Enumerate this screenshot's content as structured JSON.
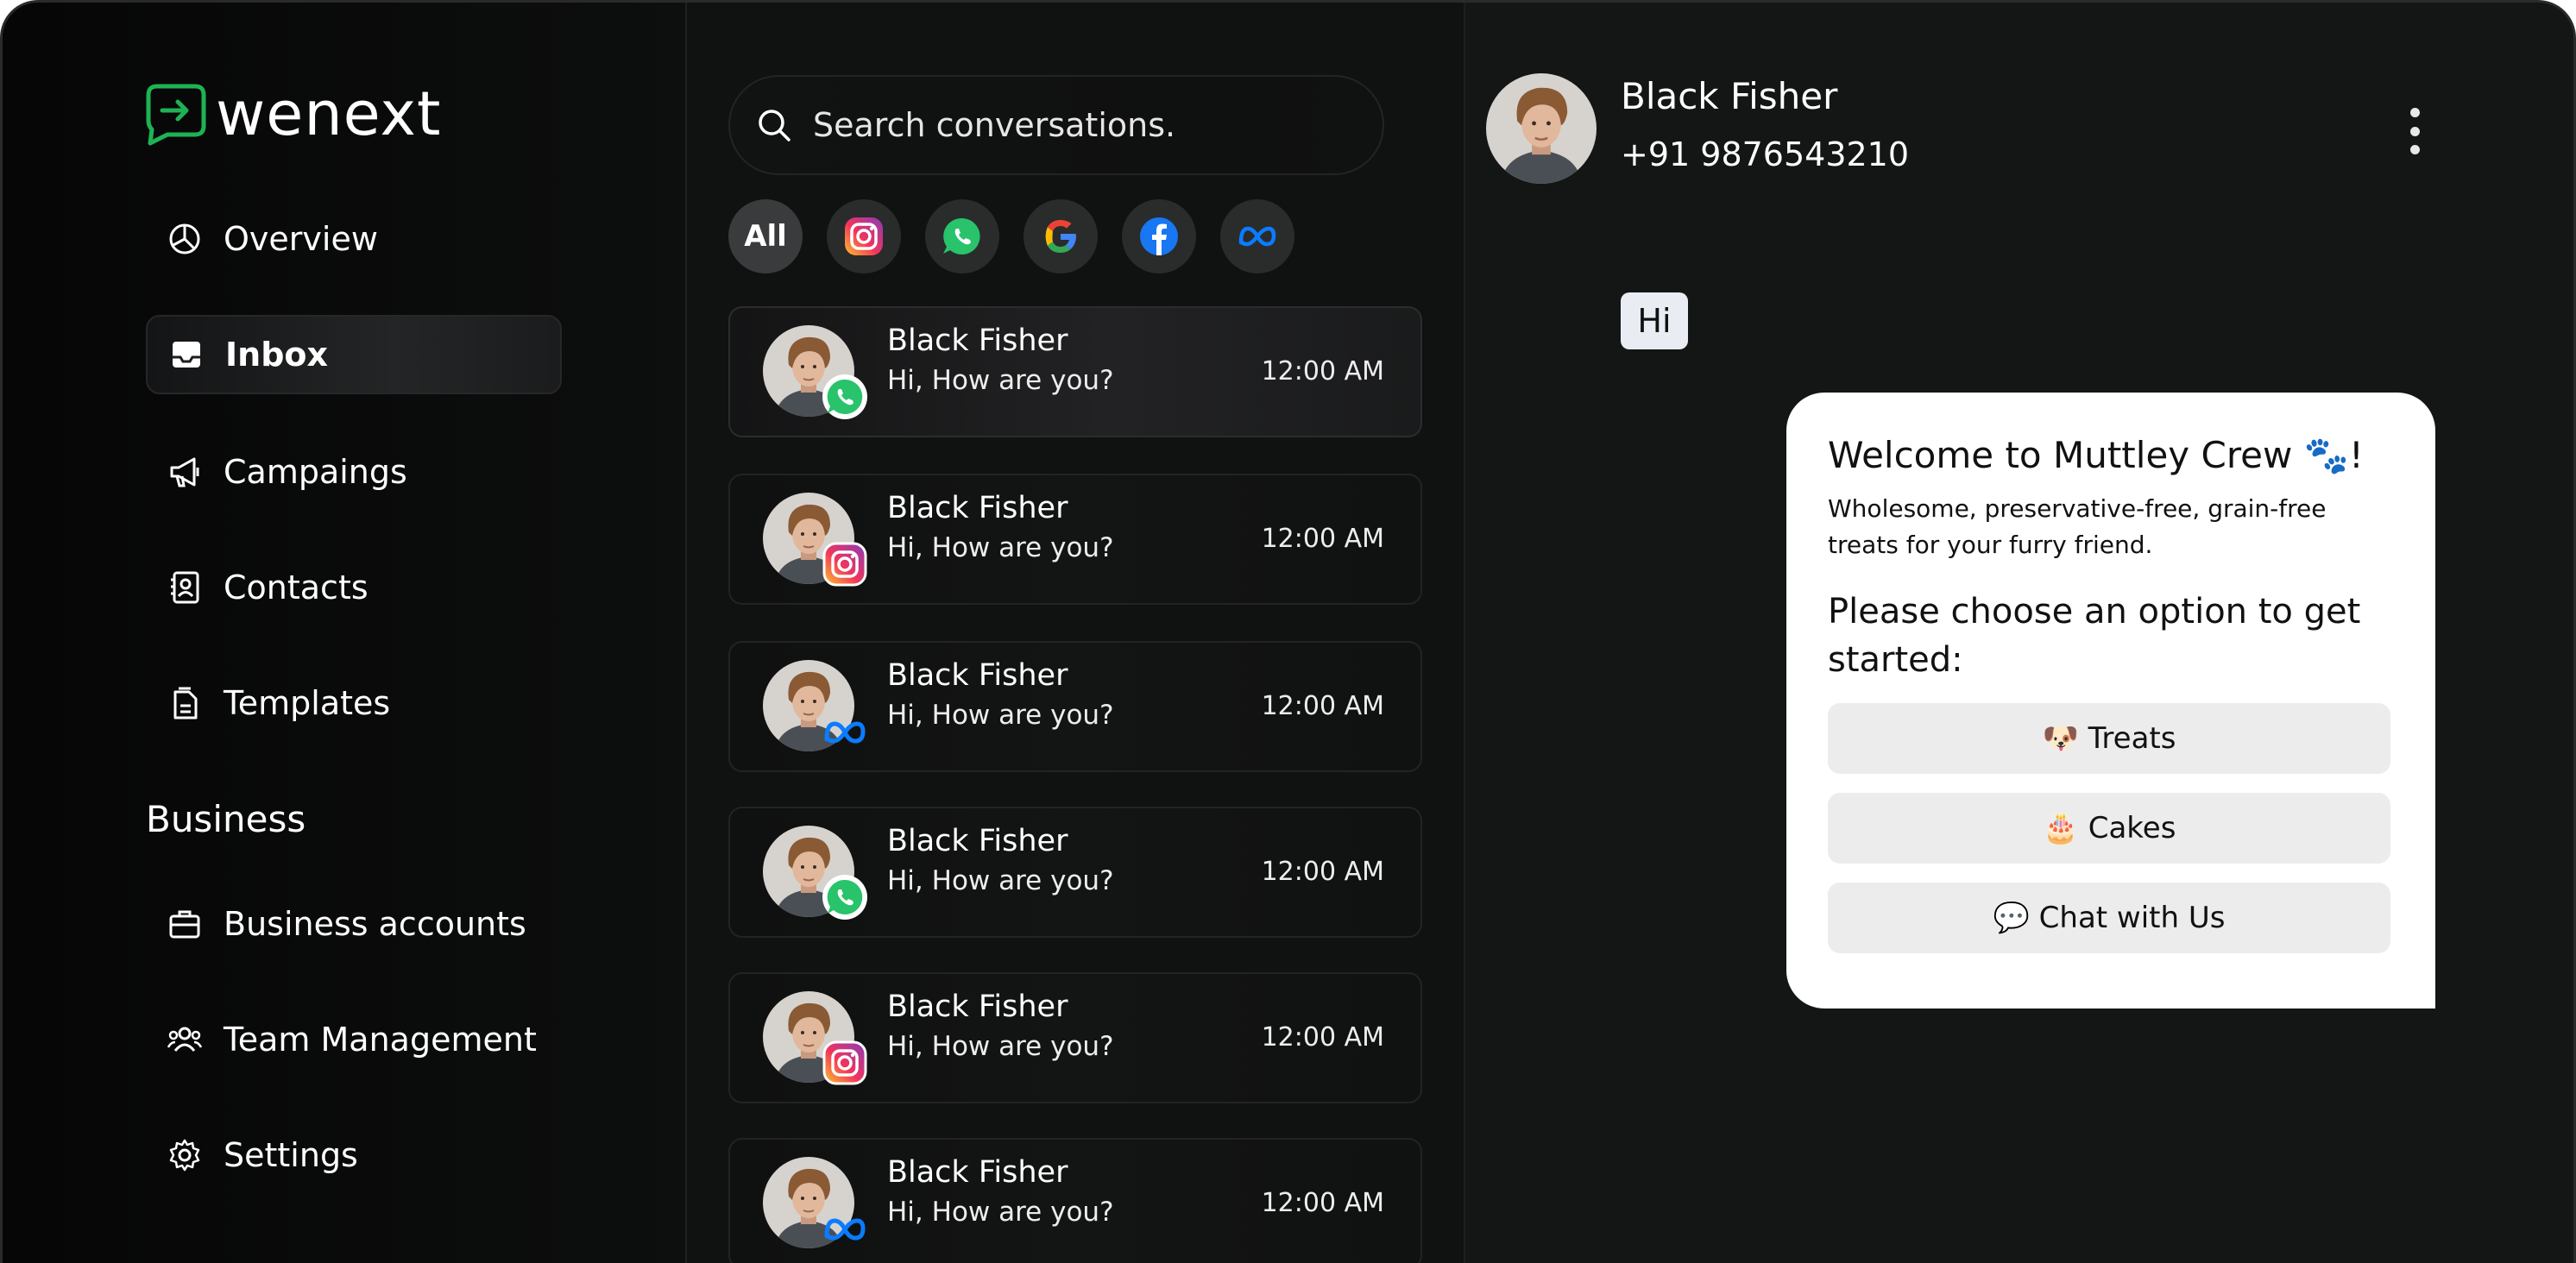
{
  "app": {
    "brand": "wenext",
    "accent_color": "#1fb254"
  },
  "sidebar": {
    "items": [
      {
        "label": "Overview",
        "icon": "pie-chart-icon"
      },
      {
        "label": "Inbox",
        "icon": "inbox-icon",
        "active": true
      },
      {
        "label": "Campaings",
        "icon": "megaphone-icon"
      },
      {
        "label": "Contacts",
        "icon": "contact-book-icon"
      },
      {
        "label": "Templates",
        "icon": "document-icon"
      }
    ],
    "section_heading": "Business",
    "business_items": [
      {
        "label": "Business accounts",
        "icon": "briefcase-icon"
      },
      {
        "label": "Team Management",
        "icon": "team-icon"
      },
      {
        "label": "Settings",
        "icon": "gear-icon"
      }
    ]
  },
  "conversations": {
    "search_placeholder": "Search conversations.",
    "filters": [
      {
        "label": "All",
        "active": true
      },
      {
        "icon": "instagram-icon"
      },
      {
        "icon": "whatsapp-icon"
      },
      {
        "icon": "google-icon"
      },
      {
        "icon": "facebook-icon"
      },
      {
        "icon": "meta-icon"
      }
    ],
    "items": [
      {
        "name": "Black Fisher",
        "preview": "Hi, How are you?",
        "time": "12:00 AM",
        "channel": "whatsapp-icon",
        "active": true
      },
      {
        "name": "Black Fisher",
        "preview": "Hi, How are you?",
        "time": "12:00 AM",
        "channel": "instagram-icon"
      },
      {
        "name": "Black Fisher",
        "preview": "Hi, How are you?",
        "time": "12:00 AM",
        "channel": "meta-icon"
      },
      {
        "name": "Black Fisher",
        "preview": "Hi, How are you?",
        "time": "12:00 AM",
        "channel": "whatsapp-icon"
      },
      {
        "name": "Black Fisher",
        "preview": "Hi, How are you?",
        "time": "12:00 AM",
        "channel": "instagram-icon"
      },
      {
        "name": "Black Fisher",
        "preview": "Hi, How are you?",
        "time": "12:00 AM",
        "channel": "meta-icon"
      }
    ]
  },
  "chat": {
    "contact_name": "Black Fisher",
    "contact_phone": "+91 9876543210",
    "incoming_message": "Hi",
    "card": {
      "title": "Welcome to Muttley Crew 🐾!",
      "subtitle": "Wholesome, preservative-free, grain-free treats for your furry friend.",
      "question": "Please choose an option to get started:",
      "options": [
        "🐶 Treats",
        "🎂 Cakes",
        "💬 Chat with Us"
      ]
    }
  }
}
